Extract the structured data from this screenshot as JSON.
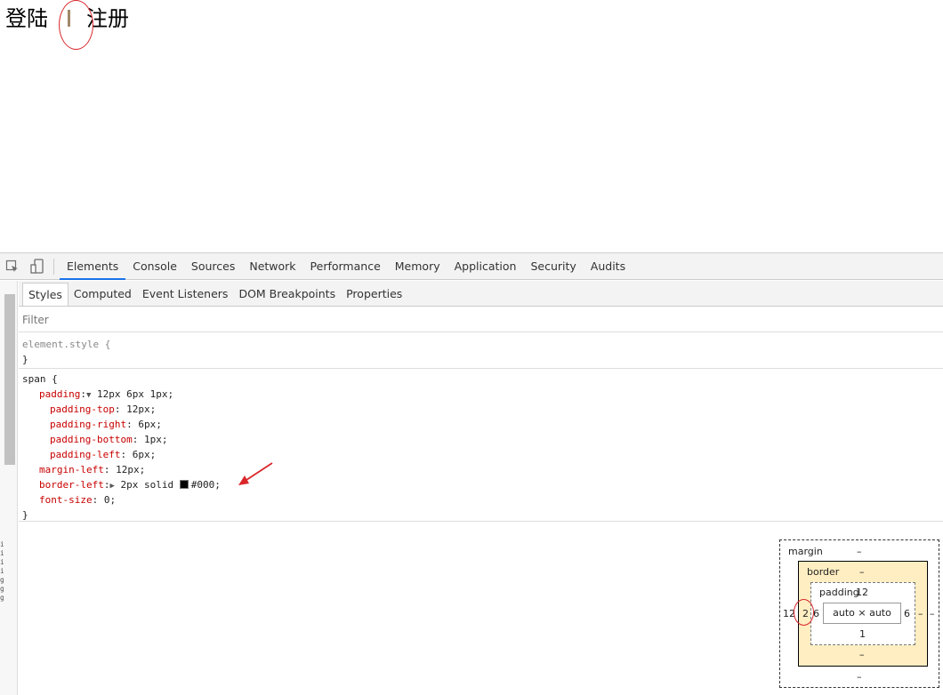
{
  "page": {
    "login_link": "登陆",
    "register_link": "注册"
  },
  "devtools": {
    "main_tabs": [
      "Elements",
      "Console",
      "Sources",
      "Network",
      "Performance",
      "Memory",
      "Application",
      "Security",
      "Audits"
    ],
    "active_main_tab": "Elements",
    "sub_tabs": [
      "Styles",
      "Computed",
      "Event Listeners",
      "DOM Breakpoints",
      "Properties"
    ],
    "active_sub_tab": "Styles",
    "filter_placeholder": "Filter",
    "element_style": {
      "selector": "element.style {",
      "close": "}"
    },
    "span_rule": {
      "selector": "span {",
      "padding_name": "padding",
      "padding_value": "12px 6px 1px;",
      "padding_top_name": "padding-top",
      "padding_top_value": "12px;",
      "padding_right_name": "padding-right",
      "padding_right_value": "6px;",
      "padding_bottom_name": "padding-bottom",
      "padding_bottom_value": "1px;",
      "padding_left_name": "padding-left",
      "padding_left_value": "6px;",
      "margin_left_name": "margin-left",
      "margin_left_value": "12px;",
      "border_left_name": "border-left",
      "border_left_value_prefix": "2px solid ",
      "border_left_color": "#000;",
      "font_size_name": "font-size",
      "font_size_value": "0;",
      "close": "}"
    },
    "box_model": {
      "margin_label": "margin",
      "margin_top": "–",
      "margin_bottom": "–",
      "margin_left": "12",
      "margin_right": "–",
      "border_label": "border",
      "border_top": "–",
      "border_bottom": "–",
      "border_left": "2",
      "border_right": "–",
      "padding_label": "padding",
      "padding_top": "12",
      "padding_bottom": "1",
      "padding_left": "6",
      "padding_right": "6",
      "content": "auto × auto"
    },
    "left_peek_text": "iiiiggg"
  },
  "colors": {
    "divider_bar": "#a0896a",
    "annotation_red": "#d9262a",
    "active_tab_underline": "#1a73e8",
    "css_property_name": "#c80000",
    "border_box_fill": "#ffeec2"
  }
}
